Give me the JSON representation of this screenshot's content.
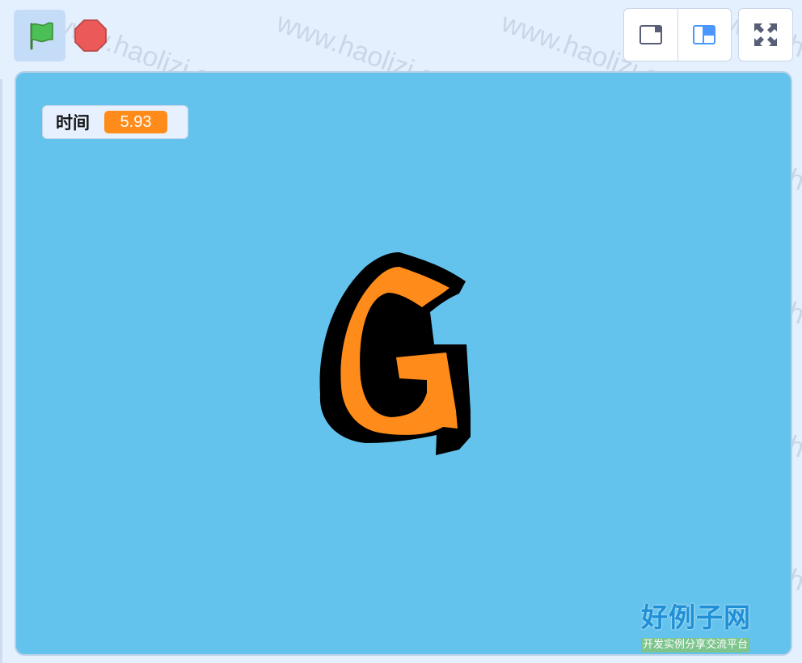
{
  "controls": {
    "green_flag_icon": "green-flag-icon",
    "stop_icon": "stop-sign-icon",
    "layout_small_icon": "small-stage-icon",
    "layout_normal_icon": "normal-stage-icon",
    "fullscreen_icon": "fullscreen-icon",
    "active_layout": "normal"
  },
  "monitor": {
    "label": "时间",
    "value": "5.93"
  },
  "sprite": {
    "glyph": "G",
    "fill_color": "#ff8c1a",
    "outline_color": "#000000"
  },
  "stage": {
    "background": "#64c3ec"
  },
  "watermark": {
    "text": "www.haolizi.com"
  },
  "branding": {
    "title": "好例子网",
    "subtitle": "开发实例分享交流平台"
  },
  "colors": {
    "accent": "#4c97ff",
    "flag_green": "#45993d",
    "stop_red": "#ec5959",
    "variable_orange": "#ff8c1a"
  }
}
